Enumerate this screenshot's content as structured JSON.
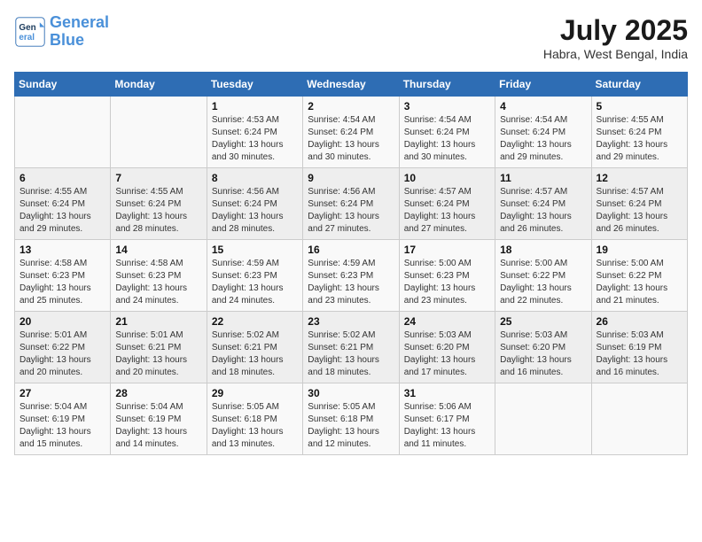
{
  "header": {
    "logo_line1": "General",
    "logo_line2": "Blue",
    "month_year": "July 2025",
    "location": "Habra, West Bengal, India"
  },
  "weekdays": [
    "Sunday",
    "Monday",
    "Tuesday",
    "Wednesday",
    "Thursday",
    "Friday",
    "Saturday"
  ],
  "weeks": [
    [
      {
        "day": "",
        "info": ""
      },
      {
        "day": "",
        "info": ""
      },
      {
        "day": "1",
        "info": "Sunrise: 4:53 AM\nSunset: 6:24 PM\nDaylight: 13 hours\nand 30 minutes."
      },
      {
        "day": "2",
        "info": "Sunrise: 4:54 AM\nSunset: 6:24 PM\nDaylight: 13 hours\nand 30 minutes."
      },
      {
        "day": "3",
        "info": "Sunrise: 4:54 AM\nSunset: 6:24 PM\nDaylight: 13 hours\nand 30 minutes."
      },
      {
        "day": "4",
        "info": "Sunrise: 4:54 AM\nSunset: 6:24 PM\nDaylight: 13 hours\nand 29 minutes."
      },
      {
        "day": "5",
        "info": "Sunrise: 4:55 AM\nSunset: 6:24 PM\nDaylight: 13 hours\nand 29 minutes."
      }
    ],
    [
      {
        "day": "6",
        "info": "Sunrise: 4:55 AM\nSunset: 6:24 PM\nDaylight: 13 hours\nand 29 minutes."
      },
      {
        "day": "7",
        "info": "Sunrise: 4:55 AM\nSunset: 6:24 PM\nDaylight: 13 hours\nand 28 minutes."
      },
      {
        "day": "8",
        "info": "Sunrise: 4:56 AM\nSunset: 6:24 PM\nDaylight: 13 hours\nand 28 minutes."
      },
      {
        "day": "9",
        "info": "Sunrise: 4:56 AM\nSunset: 6:24 PM\nDaylight: 13 hours\nand 27 minutes."
      },
      {
        "day": "10",
        "info": "Sunrise: 4:57 AM\nSunset: 6:24 PM\nDaylight: 13 hours\nand 27 minutes."
      },
      {
        "day": "11",
        "info": "Sunrise: 4:57 AM\nSunset: 6:24 PM\nDaylight: 13 hours\nand 26 minutes."
      },
      {
        "day": "12",
        "info": "Sunrise: 4:57 AM\nSunset: 6:24 PM\nDaylight: 13 hours\nand 26 minutes."
      }
    ],
    [
      {
        "day": "13",
        "info": "Sunrise: 4:58 AM\nSunset: 6:23 PM\nDaylight: 13 hours\nand 25 minutes."
      },
      {
        "day": "14",
        "info": "Sunrise: 4:58 AM\nSunset: 6:23 PM\nDaylight: 13 hours\nand 24 minutes."
      },
      {
        "day": "15",
        "info": "Sunrise: 4:59 AM\nSunset: 6:23 PM\nDaylight: 13 hours\nand 24 minutes."
      },
      {
        "day": "16",
        "info": "Sunrise: 4:59 AM\nSunset: 6:23 PM\nDaylight: 13 hours\nand 23 minutes."
      },
      {
        "day": "17",
        "info": "Sunrise: 5:00 AM\nSunset: 6:23 PM\nDaylight: 13 hours\nand 23 minutes."
      },
      {
        "day": "18",
        "info": "Sunrise: 5:00 AM\nSunset: 6:22 PM\nDaylight: 13 hours\nand 22 minutes."
      },
      {
        "day": "19",
        "info": "Sunrise: 5:00 AM\nSunset: 6:22 PM\nDaylight: 13 hours\nand 21 minutes."
      }
    ],
    [
      {
        "day": "20",
        "info": "Sunrise: 5:01 AM\nSunset: 6:22 PM\nDaylight: 13 hours\nand 20 minutes."
      },
      {
        "day": "21",
        "info": "Sunrise: 5:01 AM\nSunset: 6:21 PM\nDaylight: 13 hours\nand 20 minutes."
      },
      {
        "day": "22",
        "info": "Sunrise: 5:02 AM\nSunset: 6:21 PM\nDaylight: 13 hours\nand 18 minutes."
      },
      {
        "day": "23",
        "info": "Sunrise: 5:02 AM\nSunset: 6:21 PM\nDaylight: 13 hours\nand 18 minutes."
      },
      {
        "day": "24",
        "info": "Sunrise: 5:03 AM\nSunset: 6:20 PM\nDaylight: 13 hours\nand 17 minutes."
      },
      {
        "day": "25",
        "info": "Sunrise: 5:03 AM\nSunset: 6:20 PM\nDaylight: 13 hours\nand 16 minutes."
      },
      {
        "day": "26",
        "info": "Sunrise: 5:03 AM\nSunset: 6:19 PM\nDaylight: 13 hours\nand 16 minutes."
      }
    ],
    [
      {
        "day": "27",
        "info": "Sunrise: 5:04 AM\nSunset: 6:19 PM\nDaylight: 13 hours\nand 15 minutes."
      },
      {
        "day": "28",
        "info": "Sunrise: 5:04 AM\nSunset: 6:19 PM\nDaylight: 13 hours\nand 14 minutes."
      },
      {
        "day": "29",
        "info": "Sunrise: 5:05 AM\nSunset: 6:18 PM\nDaylight: 13 hours\nand 13 minutes."
      },
      {
        "day": "30",
        "info": "Sunrise: 5:05 AM\nSunset: 6:18 PM\nDaylight: 13 hours\nand 12 minutes."
      },
      {
        "day": "31",
        "info": "Sunrise: 5:06 AM\nSunset: 6:17 PM\nDaylight: 13 hours\nand 11 minutes."
      },
      {
        "day": "",
        "info": ""
      },
      {
        "day": "",
        "info": ""
      }
    ]
  ]
}
